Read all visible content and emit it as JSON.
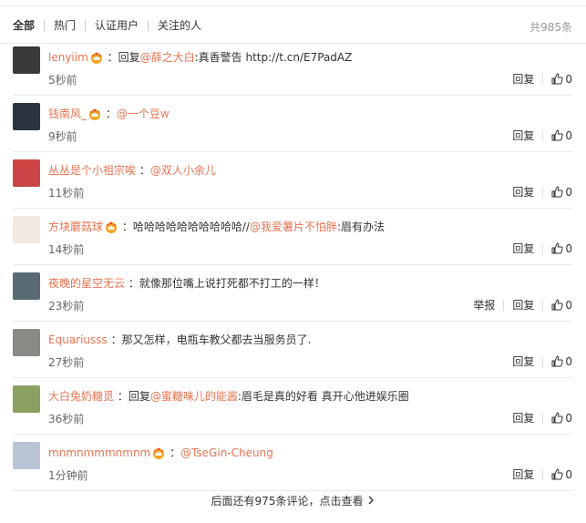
{
  "tabs": [
    "全部",
    "热门",
    "认证用户",
    "关注的人"
  ],
  "total": "共985条",
  "reply_label": "回复",
  "report_label": "举报",
  "comments": [
    {
      "user": "lenyiim",
      "crown": true,
      "prefix": "回复",
      "mention": "@薛之大白",
      "text": ":真香警告 http://t.cn/E7PadAZ",
      "time": "5秒前",
      "likes": "0",
      "avatar_color": "#3a3a3a",
      "report": false
    },
    {
      "user": "钱南风_",
      "crown": true,
      "prefix": "",
      "mention": "@一个豆w",
      "text": "",
      "time": "9秒前",
      "likes": "0",
      "avatar_color": "#2c3340",
      "report": false
    },
    {
      "user": "丛丛是个小祖宗唉",
      "crown": false,
      "prefix": "",
      "mention": "@双人小余儿",
      "text": "",
      "time": "11秒前",
      "likes": "0",
      "avatar_color": "#c44",
      "report": false
    },
    {
      "user": "方块蘑菇球",
      "crown": true,
      "prefix": "",
      "mention": "",
      "text": "哈哈哈哈哈哈哈哈哈哈//",
      "mention2": "@我爱薯片不怕胖",
      "text2": ":眉有办法",
      "time": "14秒前",
      "likes": "0",
      "avatar_color": "#f2e8e0",
      "report": false
    },
    {
      "user": "夜晚的星空无云",
      "crown": false,
      "prefix": "",
      "mention": "",
      "text": "就像那位嘴上说打死都不打工的一样！",
      "time": "23秒前",
      "likes": "0",
      "avatar_color": "#5a6a74",
      "report": true
    },
    {
      "user": "Equariusss",
      "crown": false,
      "prefix": "",
      "mention": "",
      "text": "那又怎样，电瓶车教父都去当服务员了.",
      "time": "27秒前",
      "likes": "0",
      "avatar_color": "#8a8a84",
      "report": false
    },
    {
      "user": "大白兔奶糖觅",
      "crown": false,
      "prefix": "回复",
      "mention": "@蜜糖味儿的能酱",
      "text": ":眉毛是真的好看 真开心他进娱乐圈",
      "time": "36秒前",
      "likes": "0",
      "avatar_color": "#8aa060",
      "report": false
    },
    {
      "user": "mnmnmmmnmnm",
      "crown": true,
      "prefix": "",
      "mention": "@TseGin-Cheung",
      "text": "",
      "time": "1分钟前",
      "likes": "0",
      "avatar_color": "#b8c4d4",
      "report": false
    }
  ],
  "more_text": "后面还有975条评论，点击查看",
  "colors": {
    "link": "#eb7350",
    "crown": "#f5a623",
    "divider": "#eaeaea"
  }
}
